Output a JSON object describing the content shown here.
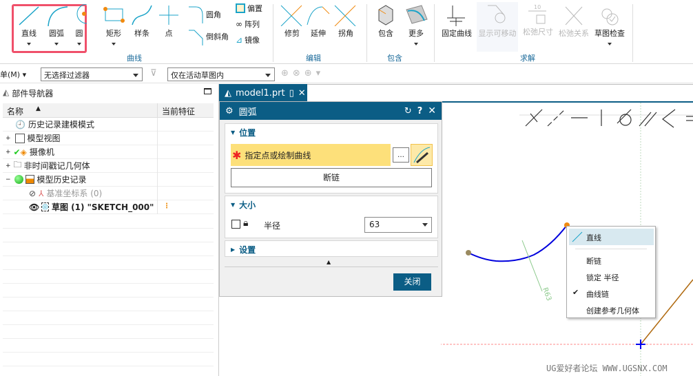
{
  "ribbon": {
    "curve": {
      "line": "直线",
      "arc": "圆弧",
      "circle": "圆",
      "rect": "矩形",
      "spline": "样条",
      "point": "点",
      "fillet": "圆角",
      "chamfer": "倒斜角",
      "offset": "偏置",
      "pattern": "阵列",
      "mirror": "镜像",
      "group": "曲线"
    },
    "edit": {
      "trim": "修剪",
      "extend": "延伸",
      "corner": "拐角",
      "group": "编辑"
    },
    "include": {
      "include": "包含",
      "more": "更多",
      "group": "包含"
    },
    "solve": {
      "fix": "固定曲线",
      "show_movable": "显示可移动",
      "relax_dim": "松弛尺寸",
      "relax_rel": "松弛关系",
      "check": "草图检查",
      "group": "求解",
      "dim_value": "10"
    }
  },
  "toolbar": {
    "menu": "单(M)",
    "filter": "无选择过滤器",
    "scope": "仅在活动草图内"
  },
  "nav": {
    "title": "部件导航器",
    "col_name": "名称",
    "col_feature": "当前特征",
    "items": [
      {
        "label": "历史记录建模模式"
      },
      {
        "label": "模型视图"
      },
      {
        "label": "摄像机"
      },
      {
        "label": "非时间戳记几何体"
      },
      {
        "label": "模型历史记录"
      },
      {
        "label": "基准坐标系 (0)"
      },
      {
        "label": "草图 (1) \"SKETCH_000\""
      }
    ]
  },
  "tab": {
    "label": "model1.prt"
  },
  "dialog": {
    "title": "圆弧",
    "position": "位置",
    "specify": "指定点或绘制曲线",
    "break_chain": "断链",
    "size": "大小",
    "radius_label": "半径",
    "radius_value": "63",
    "settings": "设置",
    "close": "关闭"
  },
  "canvas": {
    "dim_label": "R63",
    "watermark": "UG爱好者论坛 WWW.UGSNX.COM"
  },
  "context_menu": {
    "items": [
      "直线",
      "断链",
      "锁定 半径",
      "曲线链",
      "创建参考几何体"
    ],
    "checked": "曲线链"
  },
  "colors": {
    "accent": "#0b5d85",
    "highlight": "#fde07a",
    "arc": "#0000dd",
    "line": "#b06a10"
  }
}
